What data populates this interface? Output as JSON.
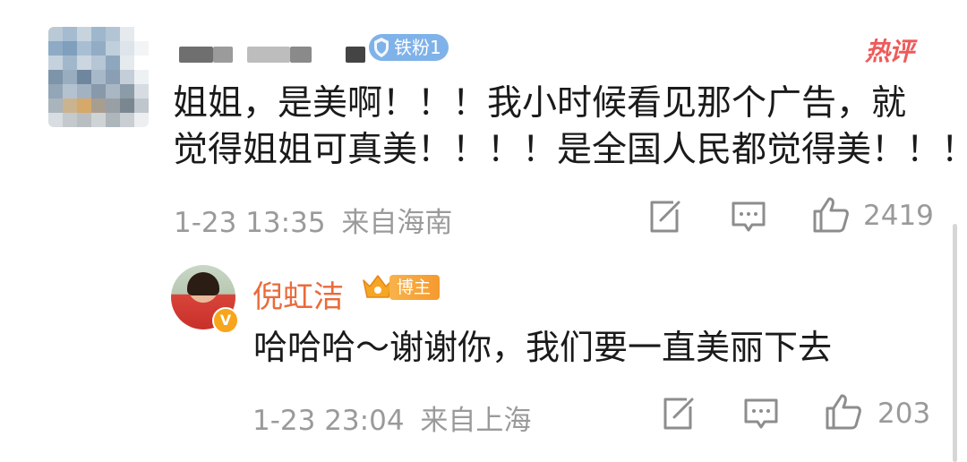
{
  "comment": {
    "fan_badge": "铁粉1",
    "hot_tag": "热评",
    "text_lines": [
      "姐姐，是美啊！！！我小时候看见那个广告，就",
      "觉得姐姐可真美！！！！是全国人民都觉得美！！！"
    ],
    "timestamp": "1-23 13:35",
    "location": "来自海南",
    "like_count": "2419",
    "icons": [
      "share-icon",
      "comment-icon",
      "like-icon"
    ]
  },
  "reply": {
    "author": "倪虹洁",
    "host_badge": "博主",
    "verified_mark": "V",
    "text": "哈哈哈～谢谢你，我们要一直美丽下去",
    "timestamp": "1-23 23:04",
    "location": "来自上海",
    "like_count": "203",
    "icons": [
      "share-icon",
      "comment-icon",
      "like-icon"
    ]
  },
  "colors": {
    "text": "#1a1a1a",
    "meta": "#9a9a9a",
    "fan_badge": "#7fb2e8",
    "hot_tag": "#ef5a5a",
    "author_name": "#ea6b3b",
    "host_badge": "#f59a2f"
  }
}
